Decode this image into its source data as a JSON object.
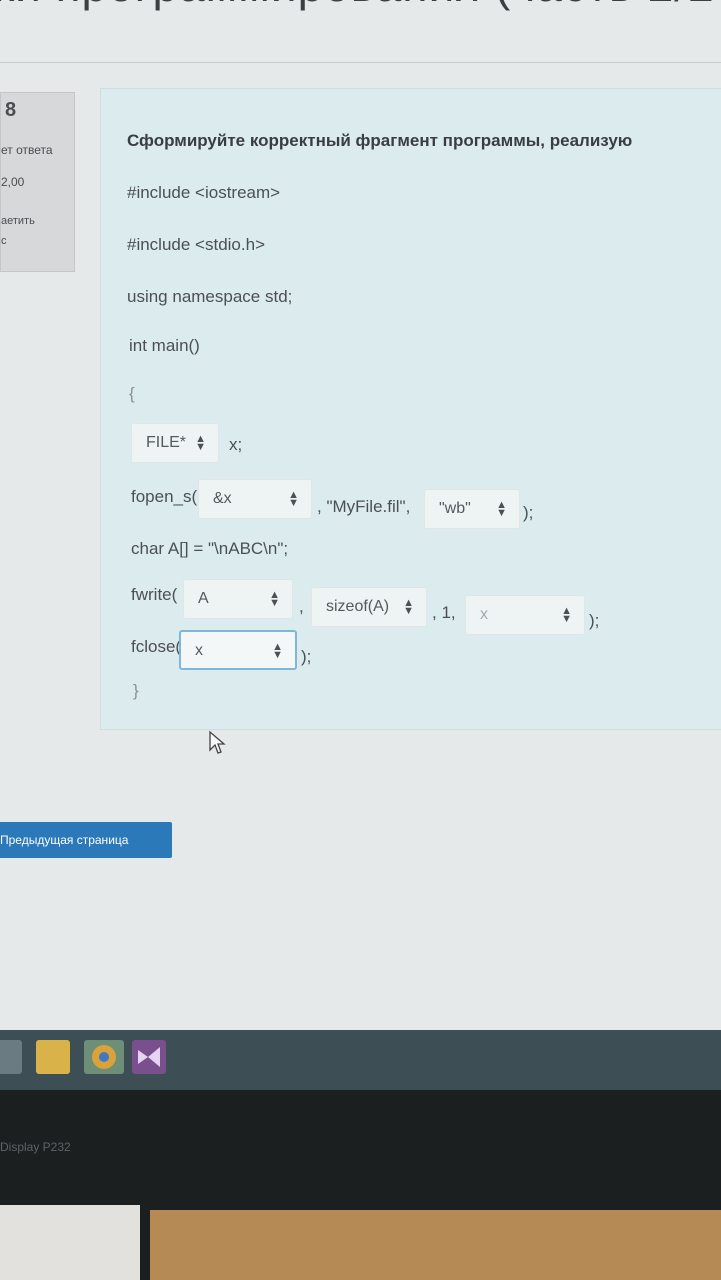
{
  "page": {
    "heading": "ки программирования (часть 2/2"
  },
  "question_info": {
    "number": "8",
    "status": "ет ответа",
    "mark": "2,00",
    "flag_line1": "аетить",
    "flag_line2": "с"
  },
  "question": {
    "text": "Сформируйте корректный фрагмент программы, реализую",
    "code": {
      "include1": "#include <iostream>",
      "include2": "#include <stdio.h>",
      "using": "using namespace std;",
      "main": "int main()",
      "open_brace": "{",
      "var_suffix": "x;",
      "fopen_prefix": "fopen_s(",
      "fopen_middle": ", \"MyFile.fil\",",
      "fopen_suffix": ");",
      "char_line": "char A[] = \"\\nABC\\n\";",
      "fwrite_prefix": "fwrite(",
      "fwrite_sep1": ",",
      "fwrite_sep2": ", 1,",
      "fwrite_suffix": ");",
      "fclose_prefix": "fclose(",
      "fclose_suffix": ");",
      "close_brace": "}"
    },
    "selects": {
      "type": "FILE*",
      "fopen_arg1": "&x",
      "fopen_mode": "\"wb\"",
      "fwrite_arg1": "A",
      "fwrite_arg2": "sizeof(A)",
      "fwrite_arg4": "x",
      "fclose_arg": "x"
    }
  },
  "nav": {
    "prev_label": "Предыдущая страница"
  },
  "taskbar": {
    "icons": [
      "windows-icon",
      "file-explorer-icon",
      "chrome-icon",
      "visual-studio-icon"
    ]
  },
  "monitor": {
    "label": "Display P232"
  }
}
